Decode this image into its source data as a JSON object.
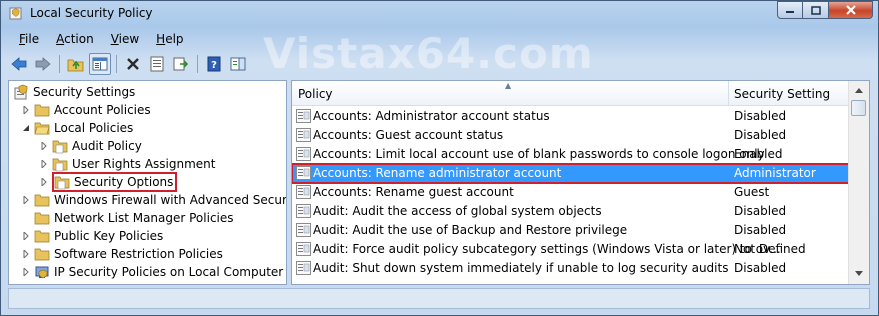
{
  "window": {
    "title": "Local Security Policy"
  },
  "menu": [
    {
      "pre": "",
      "u": "F",
      "post": "ile"
    },
    {
      "pre": "",
      "u": "A",
      "post": "ction"
    },
    {
      "pre": "",
      "u": "V",
      "post": "iew"
    },
    {
      "pre": "",
      "u": "H",
      "post": "elp"
    }
  ],
  "watermark": "Vistax64.com",
  "tree": {
    "items": [
      {
        "label": "Security Settings"
      },
      {
        "label": "Account Policies"
      },
      {
        "label": "Local Policies"
      },
      {
        "label": "Audit Policy"
      },
      {
        "label": "User Rights Assignment"
      },
      {
        "label": "Security Options"
      },
      {
        "label": "Windows Firewall with Advanced Security"
      },
      {
        "label": "Network List Manager Policies"
      },
      {
        "label": "Public Key Policies"
      },
      {
        "label": "Software Restriction Policies"
      },
      {
        "label": "IP Security Policies on Local Computer"
      }
    ]
  },
  "list": {
    "columns": {
      "policy": "Policy",
      "setting": "Security Setting"
    },
    "rows": [
      {
        "policy": "Accounts: Administrator account status",
        "setting": "Disabled"
      },
      {
        "policy": "Accounts: Guest account status",
        "setting": "Disabled"
      },
      {
        "policy": "Accounts: Limit local account use of blank passwords to console logon only",
        "setting": "Enabled"
      },
      {
        "policy": "Accounts: Rename administrator account",
        "setting": "Administrator"
      },
      {
        "policy": "Accounts: Rename guest account",
        "setting": "Guest"
      },
      {
        "policy": "Audit: Audit the access of global system objects",
        "setting": "Disabled"
      },
      {
        "policy": "Audit: Audit the use of Backup and Restore privilege",
        "setting": "Disabled"
      },
      {
        "policy": "Audit: Force audit policy subcategory settings (Windows Vista or later) to ov...",
        "setting": "Not Defined"
      },
      {
        "policy": "Audit: Shut down system immediately if unable to log security audits",
        "setting": "Disabled"
      }
    ]
  },
  "colors": {
    "selection": "#3399ff",
    "highlight_border": "#d0202e",
    "folder": "#e8c25a"
  }
}
